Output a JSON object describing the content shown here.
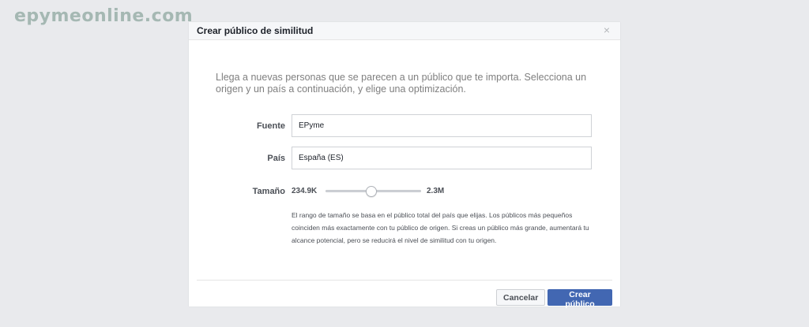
{
  "watermark": "epymeonline.com",
  "dialog": {
    "title": "Crear público de similitud",
    "close_glyph": "×",
    "intro": "Llega a nuevas personas que se parecen a un público que te importa. Selecciona un origen y un país a continuación, y elige una optimización.",
    "source": {
      "label": "Fuente",
      "value": "EPyme"
    },
    "country": {
      "label": "País",
      "value": "España (ES)"
    },
    "size": {
      "label": "Tamaño",
      "min_value": "234.9K",
      "max_value": "2.3M",
      "slider_fraction": 0.47
    },
    "help_text": "El rango de tamaño se basa en el público total del país que elijas. Los públicos más pequeños coinciden más exactamente con tu público de origen. Si creas un público más grande, aumentará tu alcance potencial, pero se reducirá el nivel de similitud con tu origen.",
    "buttons": {
      "cancel": "Cancelar",
      "create": "Crear público"
    }
  },
  "colors": {
    "background": "#e9eaed",
    "primary_button": "#4267b2",
    "watermark": "#a5b8b3"
  },
  "icons": {
    "close": "close-icon"
  }
}
